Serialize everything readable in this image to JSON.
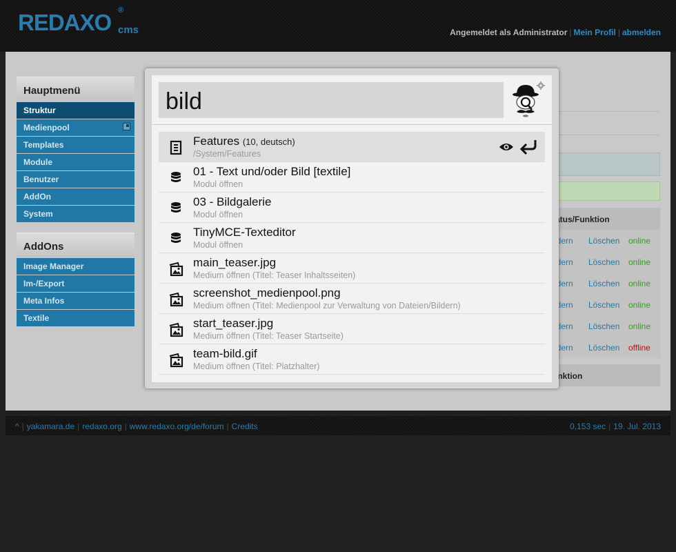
{
  "header": {
    "logo": "REDAXO",
    "logo_suffix": "cms",
    "logo_reg": "®",
    "logged_in_text": "Angemeldet als Administrator",
    "profile_link": "Mein Profil",
    "logout_link": "abmelden"
  },
  "sidebar": {
    "main_menu_title": "Hauptmenü",
    "main_items": [
      {
        "label": "Struktur",
        "active": true
      },
      {
        "label": "Medienpool",
        "has_popup_icon": true
      },
      {
        "label": "Templates"
      },
      {
        "label": "Module"
      },
      {
        "label": "Benutzer"
      },
      {
        "label": "AddOn"
      },
      {
        "label": "System"
      }
    ],
    "addons_title": "AddOns",
    "addon_items": [
      {
        "label": "Image Manager"
      },
      {
        "label": "Im-/Export"
      },
      {
        "label": "Meta Infos"
      },
      {
        "label": "Textile"
      }
    ]
  },
  "background_table": {
    "header": "tatus/Funktion",
    "footer_header": "unktion",
    "rows": [
      {
        "edit": "ndern",
        "delete": "Löschen",
        "status": "online"
      },
      {
        "edit": "ndern",
        "delete": "Löschen",
        "status": "online"
      },
      {
        "edit": "ndern",
        "delete": "Löschen",
        "status": "online"
      },
      {
        "edit": "ndern",
        "delete": "Löschen",
        "status": "online"
      },
      {
        "edit": "ndern",
        "delete": "Löschen",
        "status": "online"
      },
      {
        "edit": "ndern",
        "delete": "Löschen",
        "status": "offline"
      }
    ]
  },
  "quick_navigation": {
    "search_value": "bild",
    "results": [
      {
        "title": "Features",
        "meta": "(10, deutsch)",
        "subtitle": "/System/Features",
        "icon": "article-icon",
        "selected": true
      },
      {
        "title": "01 - Text und/oder Bild [textile]",
        "subtitle": "Modul öffnen",
        "icon": "database-icon"
      },
      {
        "title": "03 - Bildgalerie",
        "subtitle": "Modul öffnen",
        "icon": "database-icon"
      },
      {
        "title": "TinyMCE-Texteditor",
        "subtitle": "Modul öffnen",
        "icon": "database-icon"
      },
      {
        "title": "main_teaser.jpg",
        "subtitle": "Medium öffnen (Titel: Teaser Inhaltsseiten)",
        "icon": "media-icon"
      },
      {
        "title": "screenshot_medienpool.png",
        "subtitle": "Medium öffnen (Titel: Medienpool zur Verwaltung von Dateien/Bildern)",
        "icon": "media-icon"
      },
      {
        "title": "start_teaser.jpg",
        "subtitle": "Medium öffnen (Titel: Teaser Startseite)",
        "icon": "media-icon"
      },
      {
        "title": "team-bild.gif",
        "subtitle": "Medium öffnen (Titel: Platzhalter)",
        "icon": "media-icon"
      }
    ]
  },
  "footer": {
    "top_link": "^",
    "links": [
      "yakamara.de",
      "redaxo.org",
      "www.redaxo.org/de/forum",
      "Credits"
    ],
    "timing": "0,153 sec",
    "date": "19. Jul. 2013"
  },
  "colors": {
    "accent_blue": "#2078a6",
    "active_blue": "#0d4c73",
    "online_green": "#3a9a2a",
    "offline_red": "#b01515"
  }
}
